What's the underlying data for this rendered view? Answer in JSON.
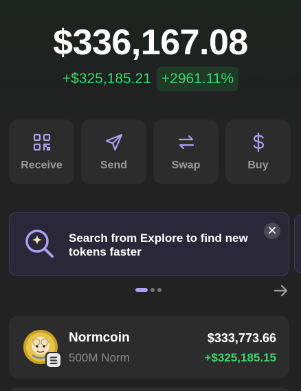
{
  "portfolio": {
    "balance": "$336,167.08",
    "change_abs": "+$325,185.21",
    "change_pct": "+2961.11%"
  },
  "actions": [
    {
      "label": "Receive",
      "icon": "qr-code-icon"
    },
    {
      "label": "Send",
      "icon": "send-icon"
    },
    {
      "label": "Swap",
      "icon": "swap-icon"
    },
    {
      "label": "Buy",
      "icon": "dollar-icon"
    }
  ],
  "banner": {
    "text": "Search from Explore to find new tokens faster",
    "icon": "search-sparkle-icon",
    "page_count": 3,
    "active_page": 1
  },
  "tokens": [
    {
      "name": "Normcoin",
      "amount": "500M Norm",
      "value": "$333,773.66",
      "pnl": "+$325,185.15",
      "chain_badge": "solana-icon"
    }
  ],
  "colors": {
    "positive": "#3dd66b",
    "accent": "#ab9ff2",
    "card": "#2c2c2c",
    "background": "#222222"
  }
}
